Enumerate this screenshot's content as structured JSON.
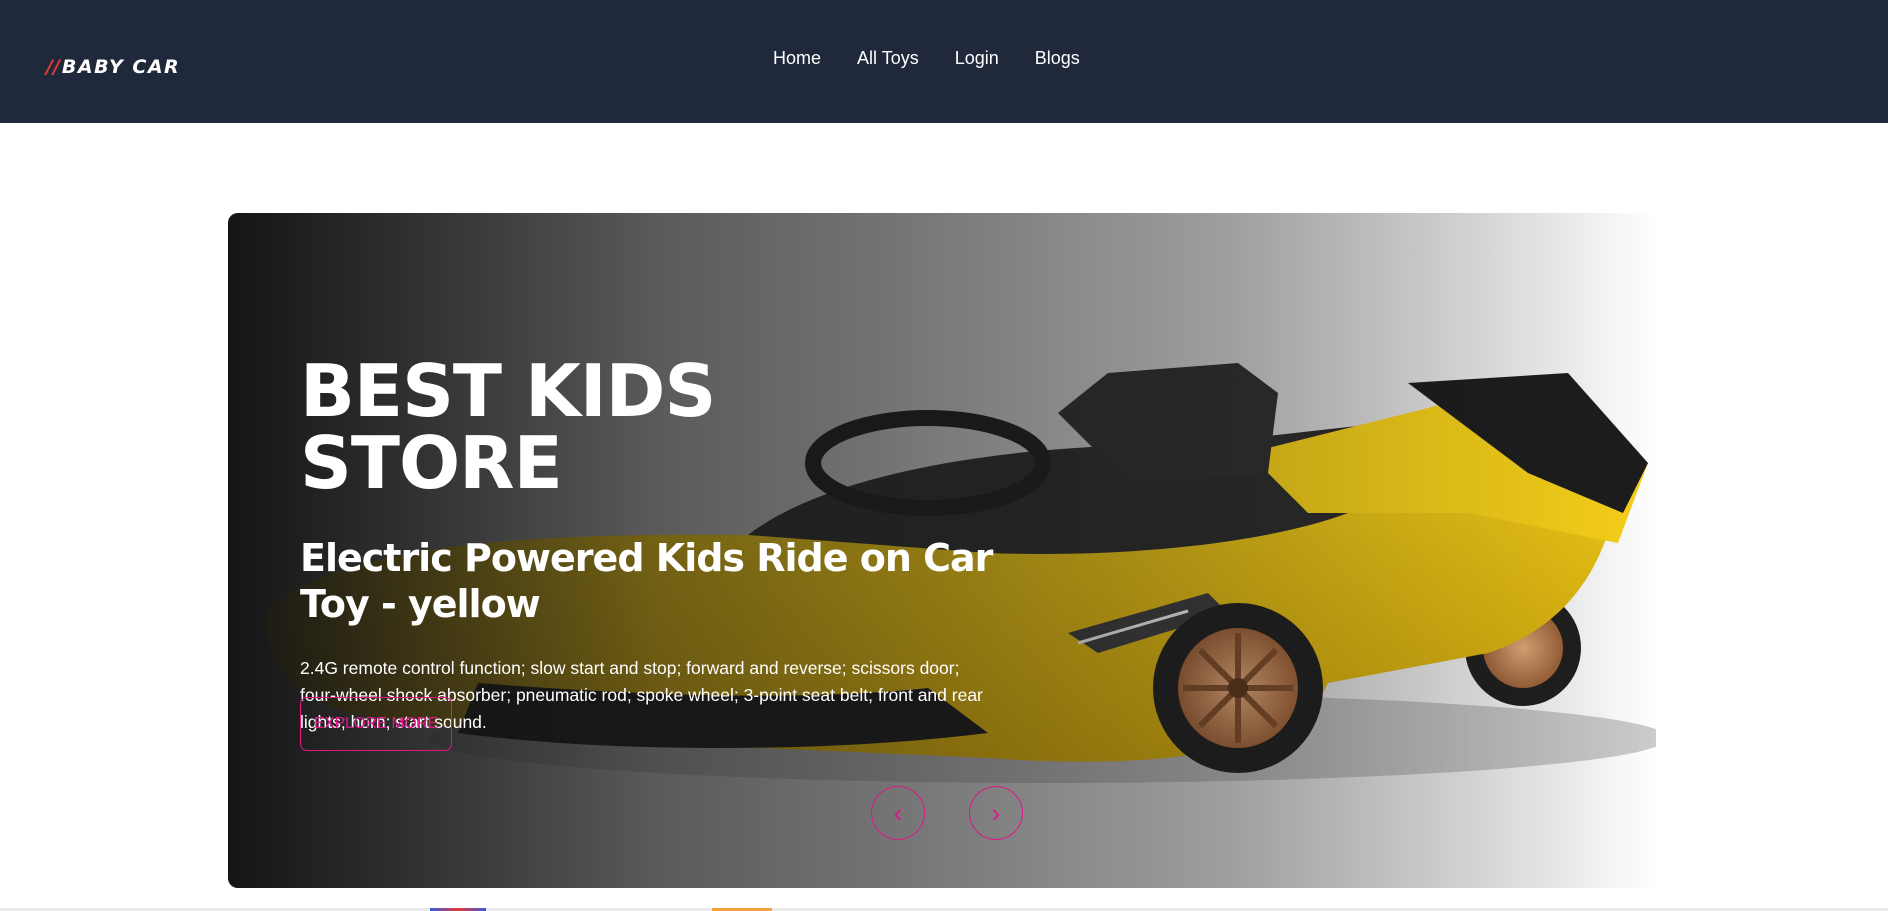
{
  "brand": {
    "slashes": "//",
    "name": "BABY CAR"
  },
  "nav": {
    "items": [
      "Home",
      "All Toys",
      "Login",
      "Blogs"
    ]
  },
  "hero": {
    "title": "BEST KIDS STORE",
    "subtitle": "Electric Powered Kids Ride on Car Toy - yellow",
    "description": "2.4G remote control function; slow start and stop; forward and reverse; scissors door; four-wheel shock absorber; pneumatic rod; spoke wheel; 3-point seat belt; front and rear lights; horn; start sound.",
    "button_label": "EXPLORE MORE",
    "prev_icon": "‹",
    "next_icon": "›"
  },
  "colors": {
    "navbar": "#1f293b",
    "accent": "#e0168a",
    "logo_slash": "#e53935",
    "car_yellow": "#f2c813"
  }
}
